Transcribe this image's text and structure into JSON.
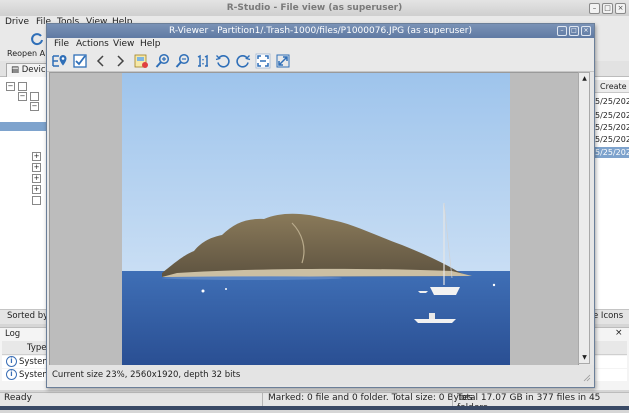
{
  "main_window": {
    "title": "R-Studio - File view (as superuser)",
    "menu": [
      "Drive",
      "File",
      "Tools",
      "View",
      "Help"
    ],
    "toolbar": {
      "reopen_label": "Reopen A"
    },
    "tabs": {
      "devices": "Devic"
    },
    "right_pane": {
      "create_header": "Create",
      "dates": [
        "5/25/202",
        "5/25/202",
        "5/25/202",
        "5/25/202",
        "5/25/202"
      ]
    },
    "sorted_label": "Sorted by",
    "large_icons_label": "e Icons",
    "log": {
      "title": "Log",
      "type_header": "Type",
      "rows": [
        "System",
        "System"
      ]
    },
    "status": {
      "ready": "Ready",
      "marked": "Marked: 0 file and 0 folder. Total size: 0 Bytes",
      "total": "Total 17.07 GB in 377 files in 45 folders"
    }
  },
  "viewer": {
    "title": "R-Viewer - Partition1/.Trash-1000/files/P1000076.JPG (as superuser)",
    "menu": [
      "File",
      "Actions",
      "View",
      "Help"
    ],
    "status": "Current size 23%, 2560x1920, depth 32 bits"
  },
  "colors": {
    "titlebar_active": "#6b84ab",
    "selection": "#7ea3cd"
  }
}
